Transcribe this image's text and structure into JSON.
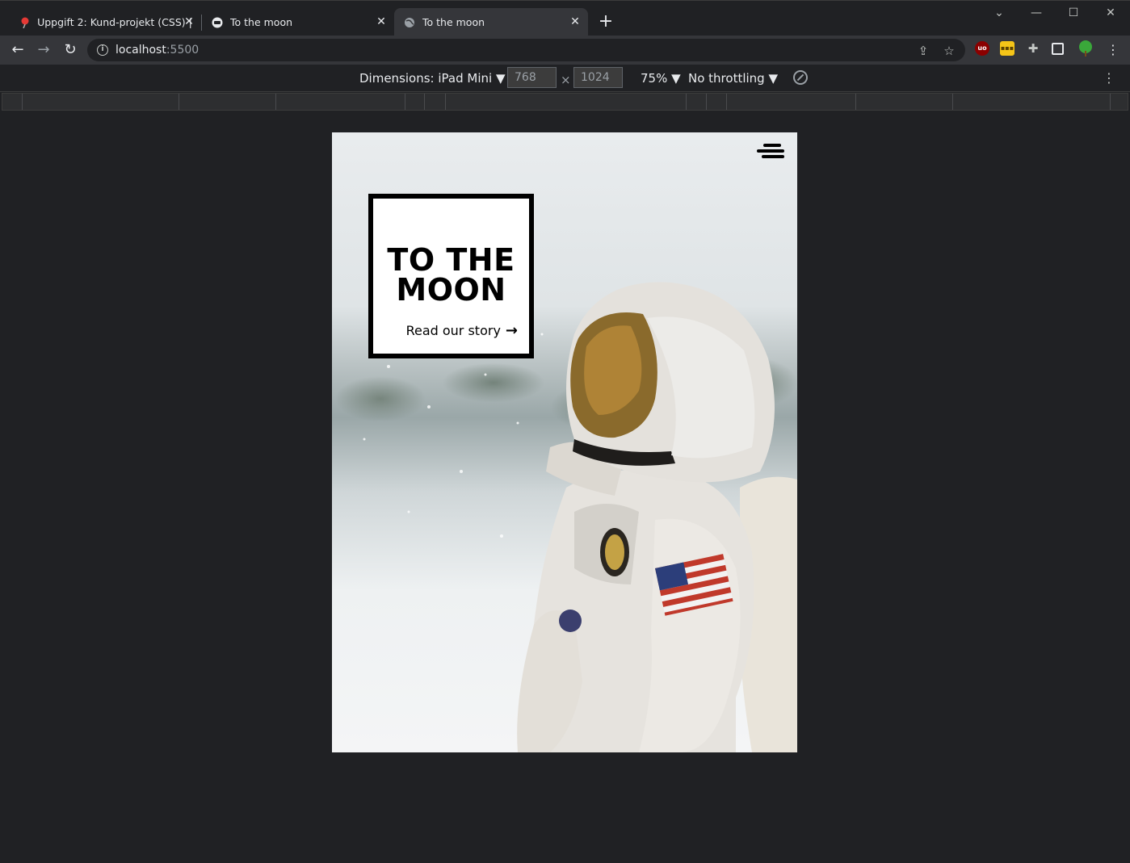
{
  "browser": {
    "tabs": [
      {
        "title": "Uppgift 2: Kund-projekt (CSS) | H",
        "icon": "pin-icon",
        "active": false
      },
      {
        "title": "To the moon",
        "icon": "site-icon",
        "active": false
      },
      {
        "title": "To the moon",
        "icon": "globe-icon",
        "active": true
      }
    ],
    "new_tab": "+",
    "window_controls": {
      "minimize": "—",
      "maximize": "☐",
      "close": "✕",
      "tab_search": "⌄"
    },
    "address": {
      "host": "localhost",
      "port": ":5500"
    }
  },
  "device_toolbar": {
    "dimensions_label": "Dimensions: iPad Mini ▼",
    "width": "768",
    "times": "×",
    "height": "1024",
    "zoom": "75% ▼",
    "throttling": "No throttling ▼"
  },
  "page": {
    "title_line1": "TO THE",
    "title_line2": "MOON",
    "story_link": "Read our story",
    "story_arrow": "→"
  },
  "colors": {
    "chrome_bg": "#202124",
    "toolbar_bg": "#35363a",
    "text": "#e8eaed",
    "box_border": "#000000"
  }
}
